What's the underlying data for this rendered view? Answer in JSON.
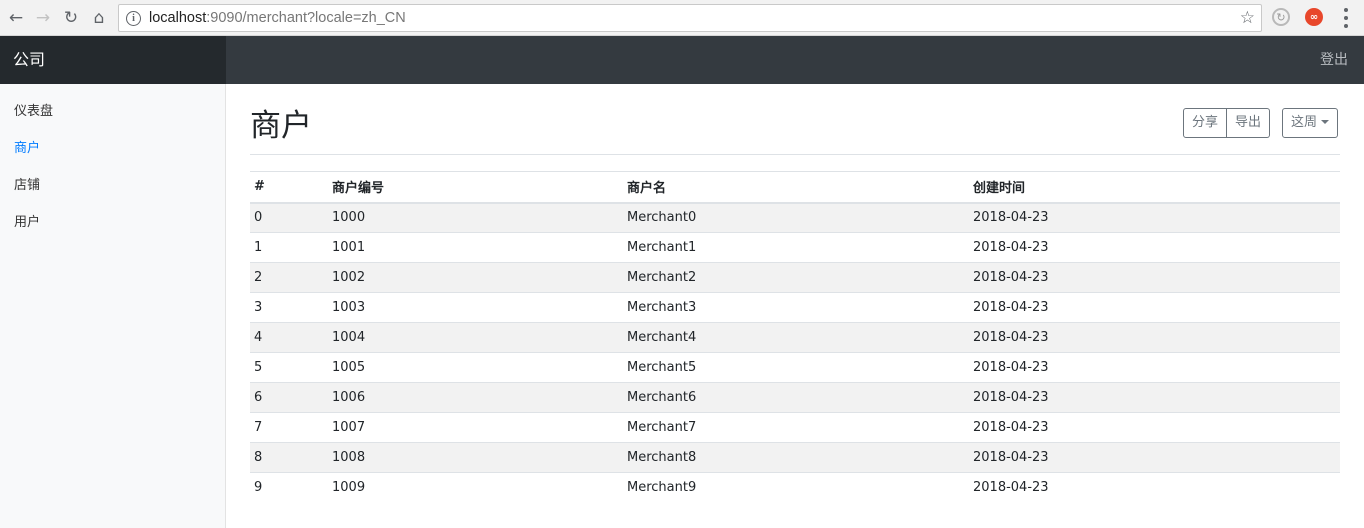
{
  "browser": {
    "url_host": "localhost",
    "url_rest": ":9090/merchant?locale=zh_CN",
    "back_icon": "arrow-left",
    "forward_icon": "arrow-right",
    "reload_icon": "reload",
    "home_icon": "home"
  },
  "navbar": {
    "brand": "公司",
    "signout": "登出"
  },
  "sidebar": {
    "items": [
      {
        "label": "仪表盘",
        "active": false
      },
      {
        "label": "商户",
        "active": true
      },
      {
        "label": "店铺",
        "active": false
      },
      {
        "label": "用户",
        "active": false
      }
    ]
  },
  "main": {
    "title": "商户",
    "buttons": {
      "share": "分享",
      "export": "导出",
      "period": "这周"
    },
    "table": {
      "headers": [
        "#",
        "商户编号",
        "商户名",
        "创建时间"
      ],
      "rows": [
        [
          "0",
          "1000",
          "Merchant0",
          "2018-04-23"
        ],
        [
          "1",
          "1001",
          "Merchant1",
          "2018-04-23"
        ],
        [
          "2",
          "1002",
          "Merchant2",
          "2018-04-23"
        ],
        [
          "3",
          "1003",
          "Merchant3",
          "2018-04-23"
        ],
        [
          "4",
          "1004",
          "Merchant4",
          "2018-04-23"
        ],
        [
          "5",
          "1005",
          "Merchant5",
          "2018-04-23"
        ],
        [
          "6",
          "1006",
          "Merchant6",
          "2018-04-23"
        ],
        [
          "7",
          "1007",
          "Merchant7",
          "2018-04-23"
        ],
        [
          "8",
          "1008",
          "Merchant8",
          "2018-04-23"
        ],
        [
          "9",
          "1009",
          "Merchant9",
          "2018-04-23"
        ]
      ]
    }
  }
}
